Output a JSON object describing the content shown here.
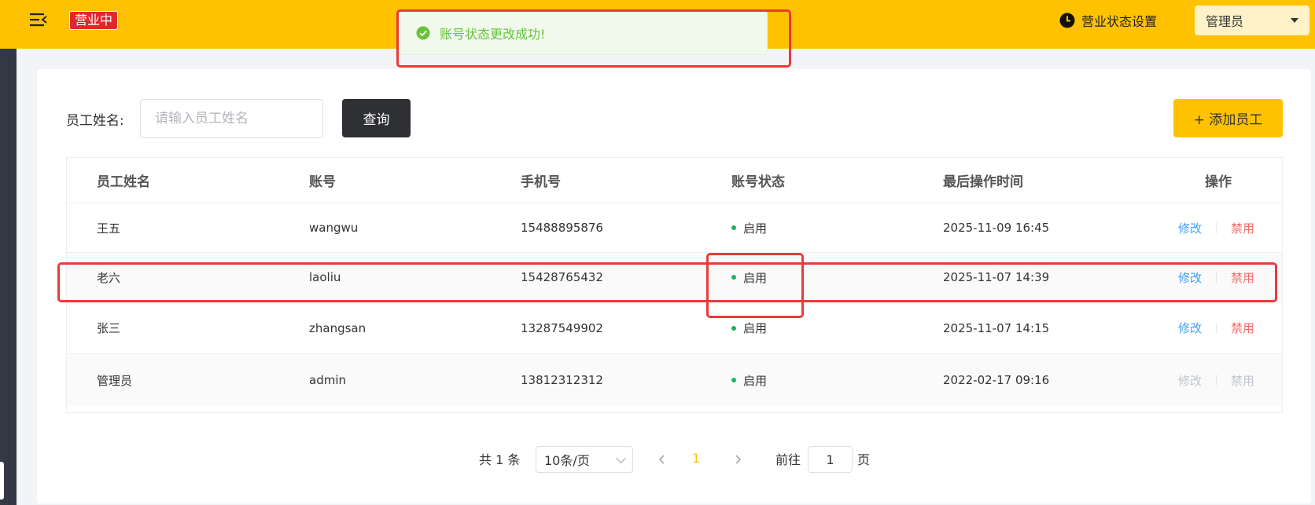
{
  "header": {
    "status_tag": "营业中",
    "biz_setting_label": "营业状态设置",
    "user_label": "管理员"
  },
  "toast": {
    "message": "账号状态更改成功!",
    "type": "success"
  },
  "filter": {
    "label": "员工姓名:",
    "placeholder": "请输入员工姓名",
    "value": "",
    "query_label": "查询",
    "add_label": "+ 添加员工"
  },
  "table": {
    "columns": [
      "员工姓名",
      "账号",
      "手机号",
      "账号状态",
      "最后操作时间",
      "操作"
    ],
    "rows": [
      {
        "name": "王五",
        "account": "wangwu",
        "phone": "15488895876",
        "status": "启用",
        "time": "2025-11-09 16:45",
        "edit": "修改",
        "disable": "禁用",
        "ops_enabled": true
      },
      {
        "name": "老六",
        "account": "laoliu",
        "phone": "15428765432",
        "status": "启用",
        "time": "2025-11-07 14:39",
        "edit": "修改",
        "disable": "禁用",
        "ops_enabled": true
      },
      {
        "name": "张三",
        "account": "zhangsan",
        "phone": "13287549902",
        "status": "启用",
        "time": "2025-11-07 14:15",
        "edit": "修改",
        "disable": "禁用",
        "ops_enabled": true
      },
      {
        "name": "管理员",
        "account": "admin",
        "phone": "13812312312",
        "status": "启用",
        "time": "2022-02-17 09:16",
        "edit": "修改",
        "disable": "禁用",
        "ops_enabled": false
      }
    ]
  },
  "pagination": {
    "total_text": "共 1 条",
    "page_size": "10条/页",
    "current_page": "1",
    "goto_label": "前往",
    "goto_value": "1",
    "page_suffix": "页"
  },
  "colors": {
    "brand": "#ffc200",
    "status_tag": "#e2272a",
    "success": "#67c23a",
    "status_dot": "#22b061",
    "link": "#419eff",
    "danger": "#f56c6c",
    "annotation": "#ea3a3a"
  }
}
